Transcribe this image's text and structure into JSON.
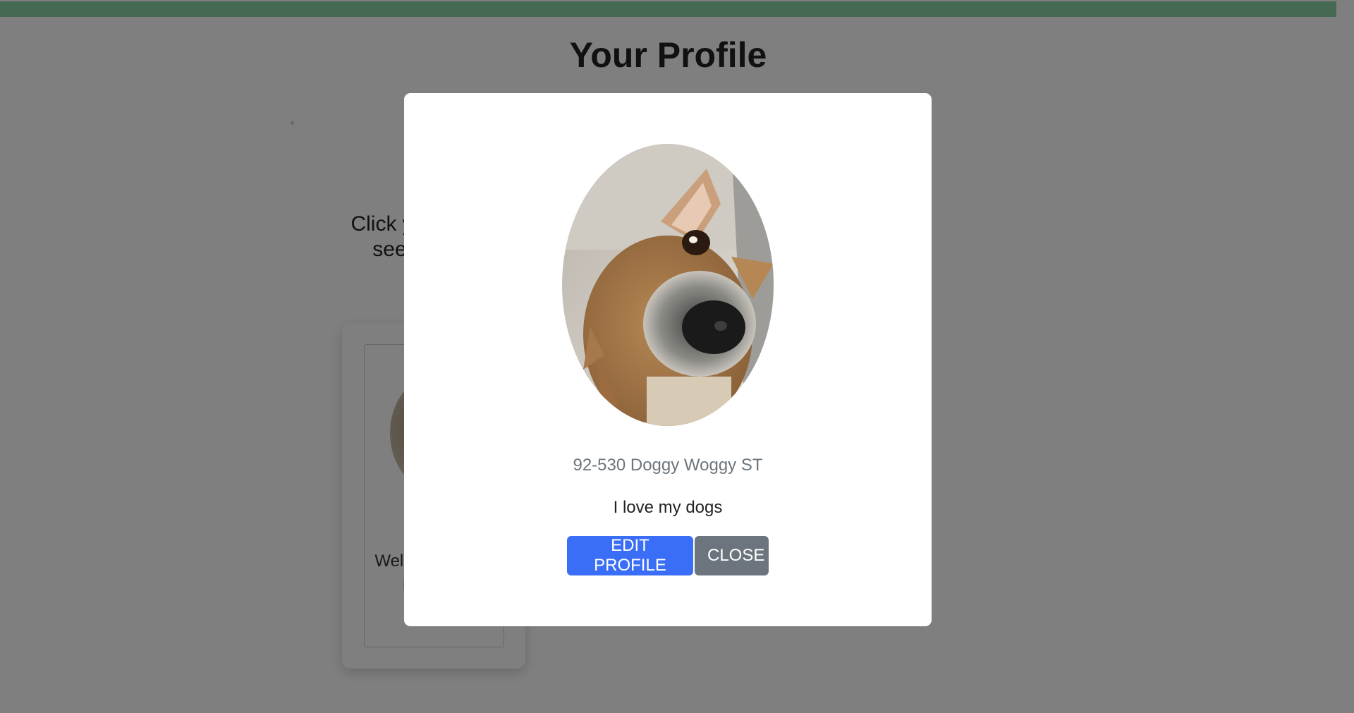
{
  "page": {
    "title": "Your Profile",
    "instruction": "Click your profile to see the details",
    "card_text": "Welcome! I love my dogs"
  },
  "modal": {
    "photo_icon": "dog-photo",
    "address": "92-530 Doggy Woggy ST",
    "bio": "I love my dogs",
    "edit_label": "EDIT PROFILE",
    "close_label": "CLOSE"
  },
  "colors": {
    "top_bar": "#8cd3a8",
    "primary_button": "#3b6ef6",
    "secondary_button": "#6c757d",
    "overlay": "rgba(0,0,0,0.5)"
  }
}
